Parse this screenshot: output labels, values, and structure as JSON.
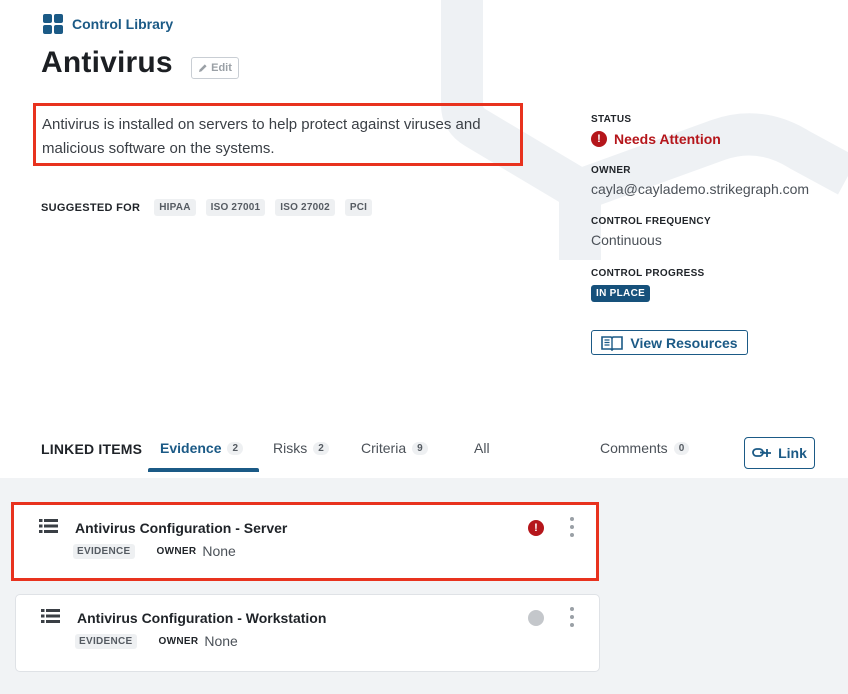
{
  "breadcrumb": {
    "label": "Control Library",
    "icon": "grid-icon"
  },
  "page": {
    "title": "Antivirus",
    "edit_label": "Edit"
  },
  "description": "Antivirus is installed on servers to help protect against viruses and malicious software on the systems.",
  "suggested": {
    "label": "SUGGESTED FOR",
    "tags": [
      "HIPAA",
      "ISO 27001",
      "ISO 27002",
      "PCI"
    ]
  },
  "sidebar": {
    "status_label": "STATUS",
    "status_value": "Needs Attention",
    "owner_label": "OWNER",
    "owner_value": "cayla@caylademo.strikegraph.com",
    "frequency_label": "CONTROL FREQUENCY",
    "frequency_value": "Continuous",
    "progress_label": "CONTROL PROGRESS",
    "progress_value": "IN PLACE",
    "resources_button": "View Resources"
  },
  "tabs": {
    "linked_items_label": "LINKED ITEMS",
    "items": [
      {
        "label": "Evidence",
        "count": "2",
        "active": true
      },
      {
        "label": "Risks",
        "count": "2"
      },
      {
        "label": "Criteria",
        "count": "9"
      },
      {
        "label": "All"
      },
      {
        "label": "Comments",
        "count": "0"
      }
    ],
    "link_button": "Link"
  },
  "evidence_list": [
    {
      "title": "Antivirus Configuration - Server",
      "type": "EVIDENCE",
      "owner_label": "OWNER",
      "owner_value": "None",
      "status": "needs-attention",
      "status_glyph": "!"
    },
    {
      "title": "Antivirus Configuration - Workstation",
      "type": "EVIDENCE",
      "owner_label": "OWNER",
      "owner_value": "None",
      "status": "not-started"
    }
  ],
  "colors": {
    "brand": "#1b5a86",
    "alert": "#b5161b",
    "highlight": "#e8321e",
    "badge": "#16517b"
  }
}
